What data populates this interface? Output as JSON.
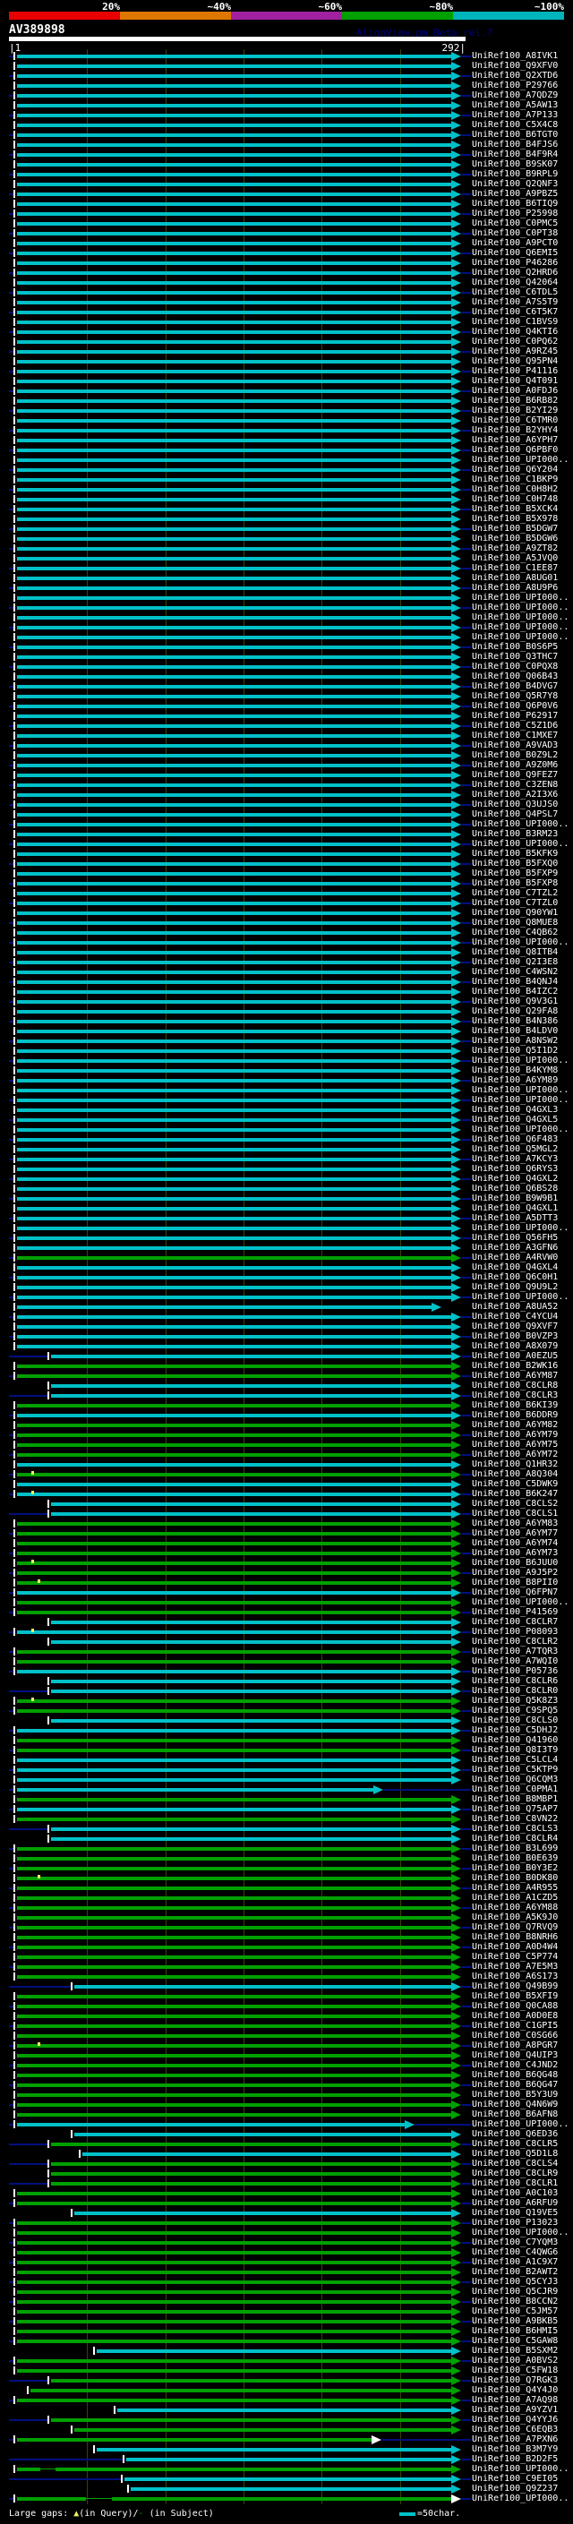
{
  "header": {
    "title": "AV389898",
    "watermark": "AlignView.pm Beta rel.7",
    "scale": [
      {
        "label": "20%",
        "color": "#e80000"
      },
      {
        "label": "~40%",
        "color": "#dd7700"
      },
      {
        "label": "~60%",
        "color": "#a020a0"
      },
      {
        "label": "~80%",
        "color": "#00a000"
      },
      {
        "label": "~100%",
        "color": "#00b4bc"
      }
    ]
  },
  "ruler": {
    "start_label": "1",
    "end_label": "292",
    "length": 292,
    "ticks": [
      50,
      100,
      150,
      200,
      250
    ]
  },
  "colors": {
    "cyan": "#00c0c8",
    "green": "#00a000",
    "navy": "#001080",
    "grid": "#3f3f00",
    "gap_mark": "#f0f060",
    "open_arrow": "#ffffff"
  },
  "legend": {
    "prefix": "Large gaps: ",
    "query_symbol": "▲",
    "mid": "(in Query)/",
    "subject_symbol": "-",
    "suffix": " (in Subject)",
    "scale_text": "=50char."
  },
  "defaults": {
    "start": 5,
    "end": 283
  },
  "rows": [
    {
      "l": "UniRef100_A8IVK1",
      "c": "c"
    },
    {
      "l": "UniRef100_Q9XFV0",
      "c": "c"
    },
    {
      "l": "UniRef100_Q2XTD6",
      "c": "c"
    },
    {
      "l": "UniRef100_P29766",
      "c": "c"
    },
    {
      "l": "UniRef100_A7QDZ9",
      "c": "c"
    },
    {
      "l": "UniRef100_A5AW13",
      "c": "c"
    },
    {
      "l": "UniRef100_A7P133",
      "c": "c"
    },
    {
      "l": "UniRef100_C5X4C8",
      "c": "c"
    },
    {
      "l": "UniRef100_B6TGT0",
      "c": "c"
    },
    {
      "l": "UniRef100_B4FJS6",
      "c": "c"
    },
    {
      "l": "UniRef100_B4F9R4",
      "c": "c"
    },
    {
      "l": "UniRef100_B9SK07",
      "c": "c"
    },
    {
      "l": "UniRef100_B9RPL9",
      "c": "c"
    },
    {
      "l": "UniRef100_Q2QNF3",
      "c": "c"
    },
    {
      "l": "UniRef100_A9PBZ5",
      "c": "c"
    },
    {
      "l": "UniRef100_B6TIQ9",
      "c": "c"
    },
    {
      "l": "UniRef100_P25998",
      "c": "c"
    },
    {
      "l": "UniRef100_C0PMC5",
      "c": "c"
    },
    {
      "l": "UniRef100_C0PT38",
      "c": "c"
    },
    {
      "l": "UniRef100_A9PCT0",
      "c": "c"
    },
    {
      "l": "UniRef100_Q6EMI5",
      "c": "c"
    },
    {
      "l": "UniRef100_P46286",
      "c": "c"
    },
    {
      "l": "UniRef100_Q2HRD6",
      "c": "c"
    },
    {
      "l": "UniRef100_Q42064",
      "c": "c"
    },
    {
      "l": "UniRef100_C6TDL5",
      "c": "c"
    },
    {
      "l": "UniRef100_A7S5T9",
      "c": "c"
    },
    {
      "l": "UniRef100_C6T5K7",
      "c": "c"
    },
    {
      "l": "UniRef100_C1BVS9",
      "c": "c"
    },
    {
      "l": "UniRef100_Q4KTI6",
      "c": "c"
    },
    {
      "l": "UniRef100_C0PQ62",
      "c": "c"
    },
    {
      "l": "UniRef100_A9RZ45",
      "c": "c"
    },
    {
      "l": "UniRef100_Q95PN4",
      "c": "c"
    },
    {
      "l": "UniRef100_P41116",
      "c": "c"
    },
    {
      "l": "UniRef100_Q4T091",
      "c": "c"
    },
    {
      "l": "UniRef100_A0FDJ6",
      "c": "c"
    },
    {
      "l": "UniRef100_B6RB82",
      "c": "c"
    },
    {
      "l": "UniRef100_B2YI29",
      "c": "c"
    },
    {
      "l": "UniRef100_C6TMR0",
      "c": "c"
    },
    {
      "l": "UniRef100_B2YHY4",
      "c": "c"
    },
    {
      "l": "UniRef100_A6YPH7",
      "c": "c"
    },
    {
      "l": "UniRef100_Q6PBF0",
      "c": "c"
    },
    {
      "l": "UniRef100_UPI000..",
      "c": "c"
    },
    {
      "l": "UniRef100_Q6Y204",
      "c": "c"
    },
    {
      "l": "UniRef100_C1BKP9",
      "c": "c"
    },
    {
      "l": "UniRef100_C0H8H2",
      "c": "c"
    },
    {
      "l": "UniRef100_C0H748",
      "c": "c"
    },
    {
      "l": "UniRef100_B5XCK4",
      "c": "c"
    },
    {
      "l": "UniRef100_B5X978",
      "c": "c"
    },
    {
      "l": "UniRef100_B5DGW7",
      "c": "c"
    },
    {
      "l": "UniRef100_B5DGW6",
      "c": "c"
    },
    {
      "l": "UniRef100_A9ZT82",
      "c": "c"
    },
    {
      "l": "UniRef100_A5JVQ0",
      "c": "c"
    },
    {
      "l": "UniRef100_C1EE87",
      "c": "c"
    },
    {
      "l": "UniRef100_A8UG01",
      "c": "c"
    },
    {
      "l": "UniRef100_A8U9P6",
      "c": "c"
    },
    {
      "l": "UniRef100_UPI000..",
      "c": "c"
    },
    {
      "l": "UniRef100_UPI000..",
      "c": "c"
    },
    {
      "l": "UniRef100_UPI000..",
      "c": "c"
    },
    {
      "l": "UniRef100_UPI000..",
      "c": "c"
    },
    {
      "l": "UniRef100_UPI000..",
      "c": "c"
    },
    {
      "l": "UniRef100_B0S6P5",
      "c": "c"
    },
    {
      "l": "UniRef100_Q3THC7",
      "c": "c"
    },
    {
      "l": "UniRef100_C0PQX8",
      "c": "c"
    },
    {
      "l": "UniRef100_Q06B43",
      "c": "c"
    },
    {
      "l": "UniRef100_B4DVG7",
      "c": "c"
    },
    {
      "l": "UniRef100_Q5R7Y8",
      "c": "c"
    },
    {
      "l": "UniRef100_Q6P0V6",
      "c": "c"
    },
    {
      "l": "UniRef100_P62917",
      "c": "c"
    },
    {
      "l": "UniRef100_C5Z1D6",
      "c": "c"
    },
    {
      "l": "UniRef100_C1MXE7",
      "c": "c"
    },
    {
      "l": "UniRef100_A9VAD3",
      "c": "c"
    },
    {
      "l": "UniRef100_B0Z9L2",
      "c": "c"
    },
    {
      "l": "UniRef100_A9Z0M6",
      "c": "c"
    },
    {
      "l": "UniRef100_Q9FEZ7",
      "c": "c"
    },
    {
      "l": "UniRef100_C3ZEN8",
      "c": "c"
    },
    {
      "l": "UniRef100_A2I3X6",
      "c": "c"
    },
    {
      "l": "UniRef100_Q3UJS0",
      "c": "c"
    },
    {
      "l": "UniRef100_Q4PSL7",
      "c": "c"
    },
    {
      "l": "UniRef100_UPI000..",
      "c": "c"
    },
    {
      "l": "UniRef100_B3RM23",
      "c": "c"
    },
    {
      "l": "UniRef100_UPI000..",
      "c": "c"
    },
    {
      "l": "UniRef100_B5KFK9",
      "c": "c"
    },
    {
      "l": "UniRef100_B5FXQ0",
      "c": "c"
    },
    {
      "l": "UniRef100_B5FXP9",
      "c": "c"
    },
    {
      "l": "UniRef100_B5FXP8",
      "c": "c"
    },
    {
      "l": "UniRef100_C7TZL2",
      "c": "c"
    },
    {
      "l": "UniRef100_C7TZL0",
      "c": "c"
    },
    {
      "l": "UniRef100_Q90YW1",
      "c": "c"
    },
    {
      "l": "UniRef100_Q8MUE8",
      "c": "c"
    },
    {
      "l": "UniRef100_C4QB62",
      "c": "c"
    },
    {
      "l": "UniRef100_UPI000..",
      "c": "c"
    },
    {
      "l": "UniRef100_Q8ITB4",
      "c": "c"
    },
    {
      "l": "UniRef100_Q2I3E8",
      "c": "c"
    },
    {
      "l": "UniRef100_C4WSN2",
      "c": "c"
    },
    {
      "l": "UniRef100_B4QNJ4",
      "c": "c"
    },
    {
      "l": "UniRef100_B4IZC2",
      "c": "c"
    },
    {
      "l": "UniRef100_Q9V3G1",
      "c": "c"
    },
    {
      "l": "UniRef100_Q29FA8",
      "c": "c"
    },
    {
      "l": "UniRef100_B4N386",
      "c": "c"
    },
    {
      "l": "UniRef100_B4LDV0",
      "c": "c"
    },
    {
      "l": "UniRef100_A8NSW2",
      "c": "c"
    },
    {
      "l": "UniRef100_Q5I1D2",
      "c": "c"
    },
    {
      "l": "UniRef100_UPI000..",
      "c": "c"
    },
    {
      "l": "UniRef100_B4KYM8",
      "c": "c"
    },
    {
      "l": "UniRef100_A6YM89",
      "c": "c"
    },
    {
      "l": "UniRef100_UPI000..",
      "c": "c"
    },
    {
      "l": "UniRef100_UPI000..",
      "c": "c"
    },
    {
      "l": "UniRef100_Q4GXL3",
      "c": "c"
    },
    {
      "l": "UniRef100_Q4GXL5",
      "c": "c"
    },
    {
      "l": "UniRef100_UPI000..",
      "c": "c"
    },
    {
      "l": "UniRef100_Q6F483",
      "c": "c"
    },
    {
      "l": "UniRef100_Q5MGL2",
      "c": "c"
    },
    {
      "l": "UniRef100_A7KCY3",
      "c": "c"
    },
    {
      "l": "UniRef100_Q6RYS3",
      "c": "c"
    },
    {
      "l": "UniRef100_Q4GXL2",
      "c": "c"
    },
    {
      "l": "UniRef100_Q6BS28",
      "c": "c"
    },
    {
      "l": "UniRef100_B9W9B1",
      "c": "c"
    },
    {
      "l": "UniRef100_Q4GXL1",
      "c": "c"
    },
    {
      "l": "UniRef100_A5DTT3",
      "c": "c"
    },
    {
      "l": "UniRef100_UPI000..",
      "c": "c"
    },
    {
      "l": "UniRef100_Q56FH5",
      "c": "c"
    },
    {
      "l": "UniRef100_A3GFN6",
      "c": "c"
    },
    {
      "l": "UniRef100_A4RVW0",
      "c": "g"
    },
    {
      "l": "UniRef100_Q4GXL4",
      "c": "c"
    },
    {
      "l": "UniRef100_Q6C0H1",
      "c": "c"
    },
    {
      "l": "UniRef100_Q9U9L2",
      "c": "c"
    },
    {
      "l": "UniRef100_UPI000..",
      "c": "c"
    },
    {
      "l": "UniRef100_A8UA52",
      "c": "c",
      "e": 270
    },
    {
      "l": "UniRef100_C4YCU4",
      "c": "c"
    },
    {
      "l": "UniRef100_Q9XVF7",
      "c": "c"
    },
    {
      "l": "UniRef100_B0VZP3",
      "c": "c"
    },
    {
      "l": "UniRef100_A8X079",
      "c": "c"
    },
    {
      "l": "UniRef100_A0EZU5",
      "c": "c",
      "s": 27
    },
    {
      "l": "UniRef100_B2WK16",
      "c": "g"
    },
    {
      "l": "UniRef100_A6YM87",
      "c": "g"
    },
    {
      "l": "UniRef100_C8CLR8",
      "c": "c",
      "s": 27
    },
    {
      "l": "UniRef100_C8CLR3",
      "c": "c",
      "s": 27
    },
    {
      "l": "UniRef100_B6KI39",
      "c": "g"
    },
    {
      "l": "UniRef100_B6DDR9",
      "c": "c"
    },
    {
      "l": "UniRef100_A6YM82",
      "c": "g"
    },
    {
      "l": "UniRef100_A6YM79",
      "c": "g"
    },
    {
      "l": "UniRef100_A6YM75",
      "c": "g"
    },
    {
      "l": "UniRef100_A6YM72",
      "c": "g"
    },
    {
      "l": "UniRef100_Q1HR32",
      "c": "c"
    },
    {
      "l": "UniRef100_A8Q304",
      "c": "g",
      "m": 15
    },
    {
      "l": "UniRef100_C5DWK9",
      "c": "c"
    },
    {
      "l": "UniRef100_B6K247",
      "c": "c",
      "m": 15
    },
    {
      "l": "UniRef100_C8CLS2",
      "c": "c",
      "s": 27
    },
    {
      "l": "UniRef100_C8CLS1",
      "c": "c",
      "s": 27
    },
    {
      "l": "UniRef100_A6YM83",
      "c": "g"
    },
    {
      "l": "UniRef100_A6YM77",
      "c": "g"
    },
    {
      "l": "UniRef100_A6YM74",
      "c": "g"
    },
    {
      "l": "UniRef100_A6YM73",
      "c": "g"
    },
    {
      "l": "UniRef100_B6JUU0",
      "c": "g",
      "m": 15
    },
    {
      "l": "UniRef100_A9J5P2",
      "c": "g"
    },
    {
      "l": "UniRef100_B8PII0",
      "c": "g",
      "m": 19
    },
    {
      "l": "UniRef100_Q6FPN7",
      "c": "c"
    },
    {
      "l": "UniRef100_UPI000..",
      "c": "g"
    },
    {
      "l": "UniRef100_P41569",
      "c": "g"
    },
    {
      "l": "UniRef100_C8CLR7",
      "c": "c",
      "s": 27
    },
    {
      "l": "UniRef100_P08093",
      "c": "c",
      "m": 15
    },
    {
      "l": "UniRef100_C8CLR2",
      "c": "c",
      "s": 27
    },
    {
      "l": "UniRef100_A7TQR3",
      "c": "g"
    },
    {
      "l": "UniRef100_A7WQI0",
      "c": "g"
    },
    {
      "l": "UniRef100_P05736",
      "c": "c"
    },
    {
      "l": "UniRef100_C8CLR6",
      "c": "c",
      "s": 27
    },
    {
      "l": "UniRef100_C8CLR0",
      "c": "c",
      "s": 27
    },
    {
      "l": "UniRef100_Q5K8Z3",
      "c": "g",
      "m": 15
    },
    {
      "l": "UniRef100_C9SPQ5",
      "c": "g"
    },
    {
      "l": "UniRef100_C8CLS0",
      "c": "c",
      "s": 27
    },
    {
      "l": "UniRef100_C5DHJ2",
      "c": "c"
    },
    {
      "l": "UniRef100_Q41960",
      "c": "g"
    },
    {
      "l": "UniRef100_Q8I3T9",
      "c": "g"
    },
    {
      "l": "UniRef100_C5LCL4",
      "c": "c"
    },
    {
      "l": "UniRef100_C5KTP9",
      "c": "c"
    },
    {
      "l": "UniRef100_Q6CQM3",
      "c": "c"
    },
    {
      "l": "UniRef100_C0PMA1",
      "c": "c",
      "e": 233
    },
    {
      "l": "UniRef100_B8MBP1",
      "c": "g"
    },
    {
      "l": "UniRef100_Q75AP7",
      "c": "c"
    },
    {
      "l": "UniRef100_C8VN22",
      "c": "g"
    },
    {
      "l": "UniRef100_C8CLS3",
      "c": "c",
      "s": 27
    },
    {
      "l": "UniRef100_C8CLR4",
      "c": "c",
      "s": 27
    },
    {
      "l": "UniRef100_B3L699",
      "c": "g"
    },
    {
      "l": "UniRef100_B0E639",
      "c": "g"
    },
    {
      "l": "UniRef100_B0Y3E2",
      "c": "g"
    },
    {
      "l": "UniRef100_B0DK80",
      "c": "g",
      "m": 19
    },
    {
      "l": "UniRef100_A4R955",
      "c": "g"
    },
    {
      "l": "UniRef100_A1CZD5",
      "c": "g"
    },
    {
      "l": "UniRef100_A6YM88",
      "c": "g"
    },
    {
      "l": "UniRef100_A5K9J0",
      "c": "g"
    },
    {
      "l": "UniRef100_Q7RVQ9",
      "c": "g"
    },
    {
      "l": "UniRef100_B8NRH6",
      "c": "g"
    },
    {
      "l": "UniRef100_A0D4W4",
      "c": "g"
    },
    {
      "l": "UniRef100_C5P774",
      "c": "g"
    },
    {
      "l": "UniRef100_A7E5M3",
      "c": "g"
    },
    {
      "l": "UniRef100_A6S173",
      "c": "g"
    },
    {
      "l": "UniRef100_Q49B99",
      "c": "c",
      "s": 42
    },
    {
      "l": "UniRef100_B5XFI9",
      "c": "g"
    },
    {
      "l": "UniRef100_Q0CA88",
      "c": "g"
    },
    {
      "l": "UniRef100_A0D0E8",
      "c": "g"
    },
    {
      "l": "UniRef100_C1GPI5",
      "c": "g"
    },
    {
      "l": "UniRef100_C0SG66",
      "c": "g"
    },
    {
      "l": "UniRef100_A8PGR7",
      "c": "g",
      "m": 19
    },
    {
      "l": "UniRef100_Q4UIP3",
      "c": "g"
    },
    {
      "l": "UniRef100_C4JND2",
      "c": "g"
    },
    {
      "l": "UniRef100_B6QG48",
      "c": "g"
    },
    {
      "l": "UniRef100_B6QG47",
      "c": "g"
    },
    {
      "l": "UniRef100_B5Y3U9",
      "c": "g"
    },
    {
      "l": "UniRef100_Q4N6W9",
      "c": "g"
    },
    {
      "l": "UniRef100_B6AFN8",
      "c": "g"
    },
    {
      "l": "UniRef100_UPI000..",
      "c": "c",
      "e": 253
    },
    {
      "l": "UniRef100_Q6ED36",
      "c": "c",
      "s": 42
    },
    {
      "l": "UniRef100_C8CLR5",
      "c": "g",
      "s": 27
    },
    {
      "l": "UniRef100_Q5D1L8",
      "c": "c",
      "s": 47
    },
    {
      "l": "UniRef100_C8CLS4",
      "c": "g",
      "s": 27
    },
    {
      "l": "UniRef100_C8CLR9",
      "c": "g",
      "s": 27
    },
    {
      "l": "UniRef100_C8CLR1",
      "c": "g",
      "s": 27
    },
    {
      "l": "UniRef100_A0C103",
      "c": "g"
    },
    {
      "l": "UniRef100_A6RFU9",
      "c": "g"
    },
    {
      "l": "UniRef100_Q19VE5",
      "c": "c",
      "s": 42
    },
    {
      "l": "UniRef100_P13023",
      "c": "g"
    },
    {
      "l": "UniRef100_UPI000..",
      "c": "g"
    },
    {
      "l": "UniRef100_C7YQM3",
      "c": "g"
    },
    {
      "l": "UniRef100_C4QWG6",
      "c": "g"
    },
    {
      "l": "UniRef100_A1C9X7",
      "c": "g"
    },
    {
      "l": "UniRef100_B2AWT2",
      "c": "g"
    },
    {
      "l": "UniRef100_Q5CYJ3",
      "c": "g"
    },
    {
      "l": "UniRef100_Q5CJR9",
      "c": "g"
    },
    {
      "l": "UniRef100_B8CCN2",
      "c": "g"
    },
    {
      "l": "UniRef100_C5JM57",
      "c": "g"
    },
    {
      "l": "UniRef100_A9BKB5",
      "c": "g"
    },
    {
      "l": "UniRef100_B6HMI5",
      "c": "g"
    },
    {
      "l": "UniRef100_C5GAW8",
      "c": "g"
    },
    {
      "l": "UniRef100_B5SXM2",
      "c": "c",
      "s": 56
    },
    {
      "l": "UniRef100_A0BVS2",
      "c": "g"
    },
    {
      "l": "UniRef100_C5FW18",
      "c": "g"
    },
    {
      "l": "UniRef100_Q7RGK3",
      "c": "g",
      "s": 27
    },
    {
      "l": "UniRef100_Q4Y4J0",
      "c": "g",
      "s": 14
    },
    {
      "l": "UniRef100_A7AQ98",
      "c": "g"
    },
    {
      "l": "UniRef100_A9YZV1",
      "c": "c",
      "s": 69
    },
    {
      "l": "UniRef100_Q4YYJ6",
      "c": "g",
      "s": 27
    },
    {
      "l": "UniRef100_C6EQB3",
      "c": "g",
      "s": 42
    },
    {
      "l": "UniRef100_A7PXN6",
      "c": "g",
      "e": 232,
      "o": true
    },
    {
      "l": "UniRef100_B3M7Y9",
      "c": "c",
      "s": 56
    },
    {
      "l": "UniRef100_B2D2F5",
      "c": "c",
      "s": 75
    },
    {
      "l": "UniRef100_UPI000..",
      "c": "g",
      "g": [
        20,
        30
      ]
    },
    {
      "l": "UniRef100_C9EI05",
      "c": "c",
      "s": 74
    },
    {
      "l": "UniRef100_Q9Z237",
      "c": "c",
      "s": 78
    },
    {
      "l": "UniRef100_UPI000..",
      "c": "g",
      "g": [
        49,
        66
      ],
      "o": true
    }
  ]
}
